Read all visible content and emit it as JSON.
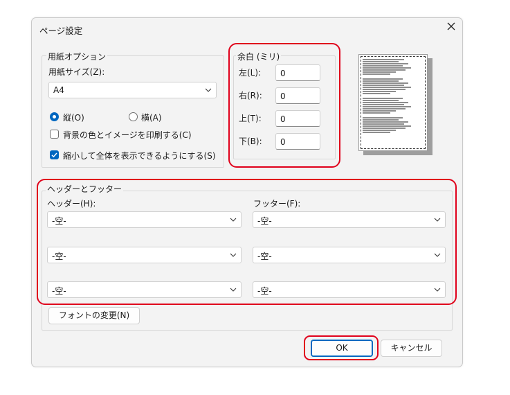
{
  "dialog": {
    "title": "ページ設定",
    "close_icon": "close-icon"
  },
  "paper": {
    "group_label": "用紙オプション",
    "size_label": "用紙サイズ(Z):",
    "size_value": "A4",
    "portrait_label": "縦(O)",
    "landscape_label": "横(A)",
    "orientation_selected": "portrait",
    "print_background_label": "背景の色とイメージを印刷する(C)",
    "print_background_checked": false,
    "shrink_to_fit_label": "縮小して全体を表示できるようにする(S)",
    "shrink_to_fit_checked": true
  },
  "margins": {
    "group_label": "余白 (ミリ)",
    "left_label": "左(L):",
    "left_value": "0",
    "right_label": "右(R):",
    "right_value": "0",
    "top_label": "上(T):",
    "top_value": "0",
    "bottom_label": "下(B):",
    "bottom_value": "0"
  },
  "header_footer": {
    "group_label": "ヘッダーとフッター",
    "header_label": "ヘッダー(H):",
    "footer_label": "フッター(F):",
    "header_values": [
      "-空-",
      "-空-",
      "-空-"
    ],
    "footer_values": [
      "-空-",
      "-空-",
      "-空-"
    ],
    "font_button_label": "フォントの変更(N)"
  },
  "buttons": {
    "ok_label": "OK",
    "cancel_label": "キャンセル"
  },
  "colors": {
    "highlight": "#e0001b",
    "accent": "#0067c0",
    "dialog_bg": "#f3f3f3"
  }
}
